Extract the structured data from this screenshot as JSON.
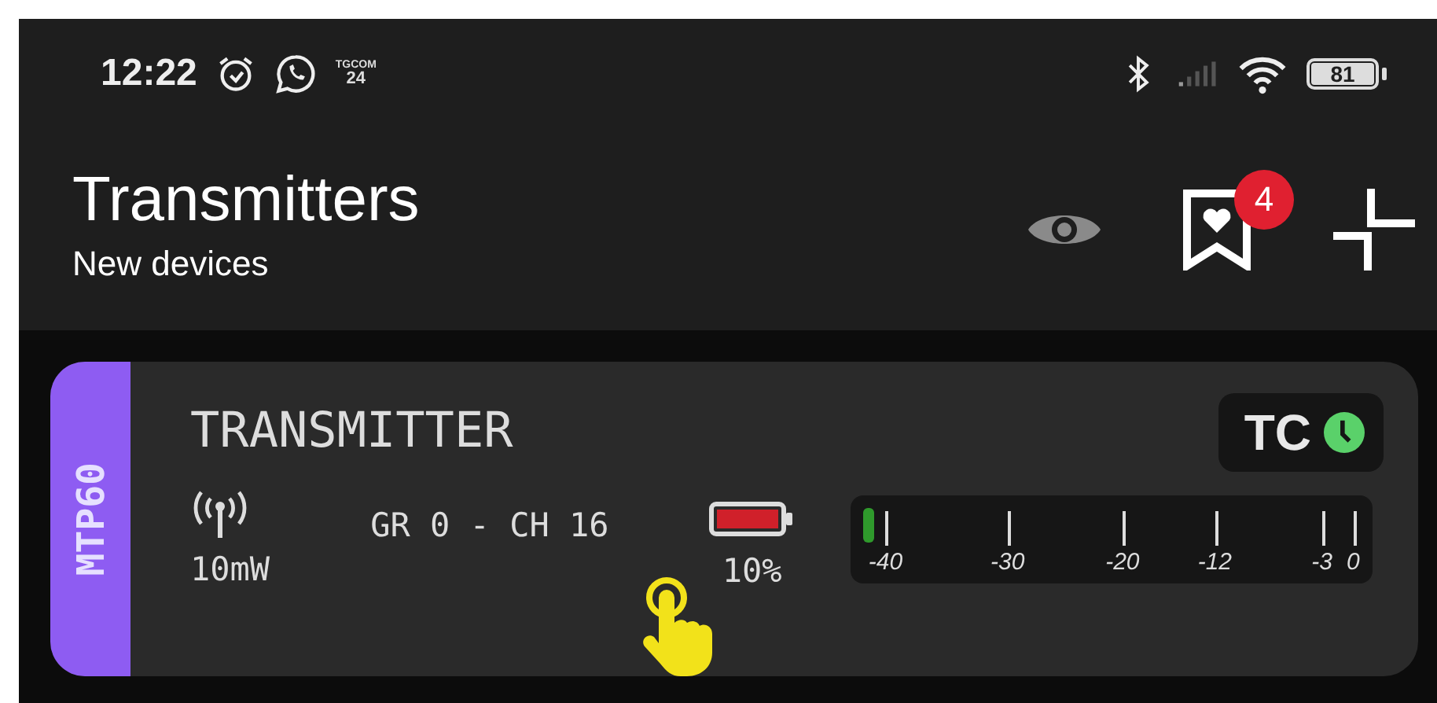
{
  "status_bar": {
    "time": "12:22",
    "app_logo": [
      "TGCOM",
      "24"
    ],
    "battery": "81"
  },
  "app_bar": {
    "title": "Transmitters",
    "subtitle": "New devices",
    "favorites_badge": "4"
  },
  "devices": [
    {
      "model": "MTP60",
      "name": "TRANSMITTER",
      "power": "10mW",
      "channel": "GR 0 - CH 16",
      "battery": "10%",
      "timecode": "TC",
      "timecode_on": true,
      "meter": {
        "level": 0.02,
        "scale": [
          "-40",
          "-30",
          "-20",
          "-12",
          "-3",
          "0"
        ]
      }
    }
  ]
}
